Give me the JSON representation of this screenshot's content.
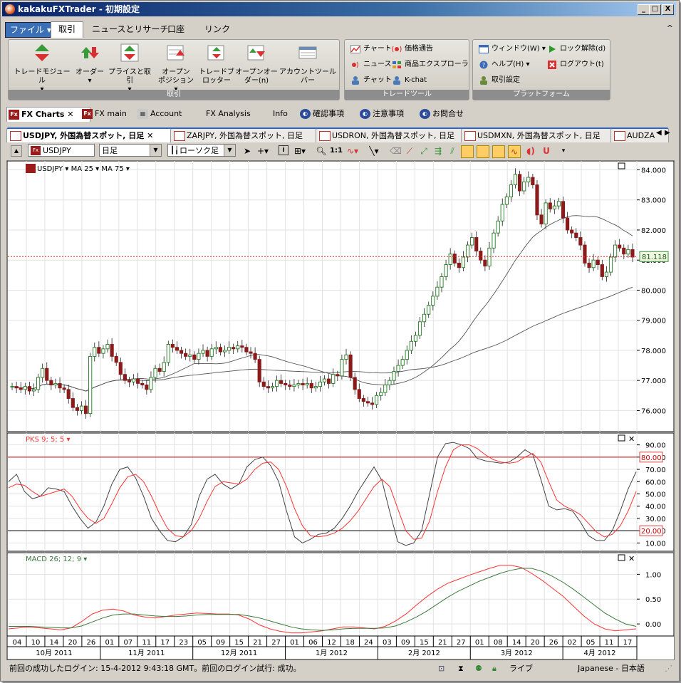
{
  "window": {
    "title": "kakakuFXTrader - 初期設定",
    "min_label": "_",
    "max_label": "□",
    "close_label": "X",
    "ribbon_collapse": "^"
  },
  "menu": {
    "file": "ファイル",
    "tabs": [
      "取引",
      "ニュースとリサーチ",
      "口座",
      "リンク"
    ]
  },
  "ribbon": {
    "trade_group": {
      "label": "取引",
      "buttons": [
        {
          "label": "トレードモジュール",
          "sub": "▾",
          "icon": "trade-module-icon"
        },
        {
          "label": "オーダー",
          "sub": "▾",
          "icon": "order-icon"
        },
        {
          "label": "プライスと取引",
          "sub": "▾",
          "icon": "price-trade-icon"
        },
        {
          "label": "オープン",
          "label2": "ポジション ▾",
          "icon": "open-position-icon"
        },
        {
          "label": "トレードブ",
          "label2": "ロッター",
          "icon": "trade-blotter-icon"
        },
        {
          "label": "オープンオー",
          "label2": "ダー(n)",
          "icon": "open-orders-icon"
        },
        {
          "label": "アカウントツールバー",
          "icon": "account-toolbar-icon"
        }
      ]
    },
    "tools_group": {
      "label": "トレードツール",
      "items": [
        "チャート",
        "価格通告",
        "ニュース",
        "商品エクスプローラ",
        "チャット",
        "K-chat"
      ]
    },
    "platform_group": {
      "label": "プラットフォーム",
      "items": [
        "ウィンドウ(W)",
        "ロック解除(d)",
        "ヘルプ(H)",
        "ログアウト(t)",
        "取引設定"
      ]
    }
  },
  "doc_tabs": [
    {
      "label": "FX Charts",
      "active": true
    },
    {
      "label": "FX main"
    },
    {
      "label": "Account"
    },
    {
      "label": "FX Analysis"
    },
    {
      "label": "Info"
    },
    {
      "label": "確認事項"
    },
    {
      "label": "注意事項"
    },
    {
      "label": "お問合せ"
    }
  ],
  "chart_tabs": [
    {
      "label": "USDJPY, 外国為替スポット, 日足",
      "active": true
    },
    {
      "label": "ZARJPY, 外国為替スポット, 日足"
    },
    {
      "label": "USDRON, 外国為替スポット, 日足"
    },
    {
      "label": "USDMXN, 外国為替スポット, 日足"
    },
    {
      "label": "AUDZA"
    }
  ],
  "toolbar": {
    "symbol": "USDJPY",
    "period": "日足",
    "chart_style": "ローソク足"
  },
  "colors": {
    "candle_up": "#1f7a1f",
    "candle_down": "#8b1a1a",
    "ma_line": "#555555",
    "stoch_k": "#444444",
    "stoch_d": "#ff3333",
    "macd_main": "#ff3333",
    "macd_signal": "#3a7a3a",
    "price_line": "#ee2222"
  },
  "chart_data": [
    {
      "type": "candlestick",
      "legend": [
        "USDJPY ▾",
        "MA 25 ▾",
        "MA 75 ▾"
      ],
      "ylim": [
        75.3,
        84.2
      ],
      "y_ticks": [
        "84.000",
        "83.000",
        "82.000",
        "81.000",
        "80.000",
        "79.000",
        "78.000",
        "77.000",
        "76.000"
      ],
      "current_price": "81.118",
      "current_value": 81.118,
      "close": [
        76.8,
        76.75,
        76.7,
        76.8,
        76.65,
        76.7,
        77.1,
        77.4,
        77.0,
        76.85,
        76.9,
        76.75,
        76.7,
        76.4,
        76.1,
        76.0,
        76.15,
        75.9,
        77.8,
        78.1,
        77.9,
        78.05,
        78.2,
        77.8,
        77.6,
        77.2,
        77.0,
        76.95,
        77.05,
        76.9,
        76.85,
        76.7,
        77.1,
        77.4,
        77.3,
        77.6,
        78.2,
        78.1,
        78.0,
        77.9,
        77.8,
        77.85,
        77.7,
        77.9,
        78.0,
        77.8,
        78.05,
        78.1,
        77.95,
        78.0,
        78.1,
        78.05,
        78.15,
        78.1,
        77.95,
        77.9,
        77.7,
        76.95,
        76.8,
        76.75,
        76.8,
        77.0,
        76.9,
        76.85,
        76.8,
        76.85,
        76.9,
        76.85,
        76.9,
        76.75,
        76.8,
        76.95,
        77.05,
        76.9,
        77.2,
        77.15,
        77.7,
        77.85,
        77.1,
        76.7,
        76.4,
        76.3,
        76.25,
        76.2,
        76.5,
        76.6,
        76.85,
        77.0,
        77.3,
        77.5,
        77.7,
        78.0,
        78.3,
        78.5,
        78.95,
        79.2,
        79.5,
        79.8,
        80.1,
        80.45,
        80.85,
        81.2,
        80.9,
        80.75,
        81.1,
        81.5,
        81.75,
        81.3,
        81.0,
        80.8,
        81.4,
        81.9,
        82.3,
        82.85,
        83.1,
        83.5,
        83.85,
        83.3,
        83.6,
        83.75,
        83.5,
        82.5,
        82.2,
        82.9,
        82.7,
        82.8,
        82.95,
        82.4,
        82.0,
        81.9,
        81.75,
        81.5,
        80.9,
        80.75,
        81.0,
        80.85,
        80.45,
        80.6,
        81.1,
        81.5,
        81.4,
        81.2,
        81.35,
        81.1
      ]
    },
    {
      "type": "line",
      "title": "PKS 9; 5; 5 ▾",
      "ylim": [
        5,
        95
      ],
      "y_ticks": [
        "90.00",
        "80.00",
        "70.00",
        "60.00",
        "50.00",
        "40.00",
        "30.00",
        "20.00",
        "10.00"
      ],
      "levels": [
        "80.00",
        "20.00"
      ],
      "level_values": [
        80,
        20
      ],
      "series": [
        {
          "values": [
            60,
            66,
            52,
            46,
            48,
            55,
            54,
            52,
            40,
            30,
            22,
            27,
            40,
            58,
            70,
            72,
            63,
            48,
            30,
            20,
            12,
            11,
            15,
            25,
            48,
            62,
            66,
            58,
            54,
            58,
            72,
            78,
            80,
            73,
            60,
            36,
            15,
            10,
            13,
            17,
            18,
            22,
            30,
            40,
            52,
            62,
            72,
            61,
            35,
            11,
            8,
            10,
            20,
            50,
            80,
            91,
            92,
            90,
            87,
            79,
            77,
            76,
            75,
            76,
            80,
            86,
            82,
            62,
            40,
            37,
            38,
            36,
            27,
            16,
            12,
            12,
            20,
            36,
            54,
            68
          ]
        },
        {
          "values": [
            55,
            58,
            57,
            52,
            48,
            50,
            52,
            54,
            48,
            38,
            30,
            26,
            30,
            42,
            55,
            64,
            66,
            60,
            48,
            34,
            22,
            16,
            15,
            20,
            30,
            44,
            56,
            60,
            59,
            58,
            62,
            70,
            75,
            76,
            70,
            56,
            38,
            24,
            16,
            15,
            16,
            18,
            22,
            28,
            36,
            46,
            56,
            62,
            56,
            38,
            20,
            13,
            14,
            28,
            52,
            72,
            86,
            90,
            90,
            87,
            82,
            78,
            76,
            75,
            76,
            80,
            83,
            76,
            60,
            45,
            40,
            37,
            33,
            26,
            19,
            15,
            17,
            24,
            36,
            52
          ]
        }
      ]
    },
    {
      "type": "line",
      "title": "MACD 26; 12; 9 ▾",
      "ylim": [
        -0.2,
        1.35
      ],
      "y_ticks": [
        "1.00",
        "0.50",
        "0.00"
      ],
      "series": [
        {
          "values": [
            -0.1,
            -0.08,
            -0.06,
            -0.08,
            -0.1,
            -0.12,
            -0.08,
            0.05,
            0.2,
            0.28,
            0.3,
            0.26,
            0.18,
            0.14,
            0.12,
            0.15,
            0.18,
            0.2,
            0.22,
            0.21,
            0.2,
            0.2,
            0.18,
            0.1,
            -0.02,
            -0.1,
            -0.15,
            -0.18,
            -0.18,
            -0.16,
            -0.14,
            -0.1,
            -0.06,
            -0.06,
            -0.08,
            -0.1,
            -0.05,
            0.06,
            0.2,
            0.38,
            0.55,
            0.7,
            0.82,
            0.9,
            0.98,
            1.05,
            1.12,
            1.18,
            1.18,
            1.14,
            1.02,
            0.88,
            0.72,
            0.56,
            0.36,
            0.16,
            0.0,
            -0.1,
            -0.14,
            -0.12,
            -0.1
          ]
        },
        {
          "values": [
            -0.05,
            -0.05,
            -0.05,
            -0.06,
            -0.07,
            -0.08,
            -0.08,
            -0.04,
            0.04,
            0.12,
            0.18,
            0.2,
            0.2,
            0.18,
            0.16,
            0.15,
            0.15,
            0.16,
            0.18,
            0.19,
            0.19,
            0.19,
            0.19,
            0.16,
            0.12,
            0.06,
            0.0,
            -0.06,
            -0.1,
            -0.12,
            -0.13,
            -0.12,
            -0.1,
            -0.09,
            -0.09,
            -0.09,
            -0.08,
            -0.04,
            0.04,
            0.14,
            0.26,
            0.4,
            0.54,
            0.66,
            0.76,
            0.86,
            0.94,
            1.02,
            1.08,
            1.12,
            1.12,
            1.06,
            0.96,
            0.84,
            0.7,
            0.54,
            0.38,
            0.22,
            0.1,
            0.0,
            -0.05
          ]
        }
      ]
    }
  ],
  "x_axis": {
    "days": [
      "04",
      "10",
      "14",
      "20",
      "26",
      "01",
      "07",
      "11",
      "17",
      "23",
      "05",
      "09",
      "15",
      "21",
      "27",
      "01",
      "06",
      "12",
      "18",
      "24",
      "03",
      "09",
      "15",
      "21",
      "27",
      "01",
      "08",
      "14",
      "20",
      "26",
      "02",
      "05",
      "11",
      "17"
    ],
    "months": [
      "10月 2011",
      "11月 2011",
      "12月 2011",
      "1月 2012",
      "2月 2012",
      "3月 2012",
      "4月 2012"
    ]
  },
  "panel_controls": {
    "restore": "□",
    "close": "✕"
  },
  "status": {
    "message": "前回の成功したログイン: 15-4-2012 9:43:18 GMT。前回のログイン試行: 成功。",
    "mode": "ライブ",
    "language": "Japanese - 日本語"
  }
}
